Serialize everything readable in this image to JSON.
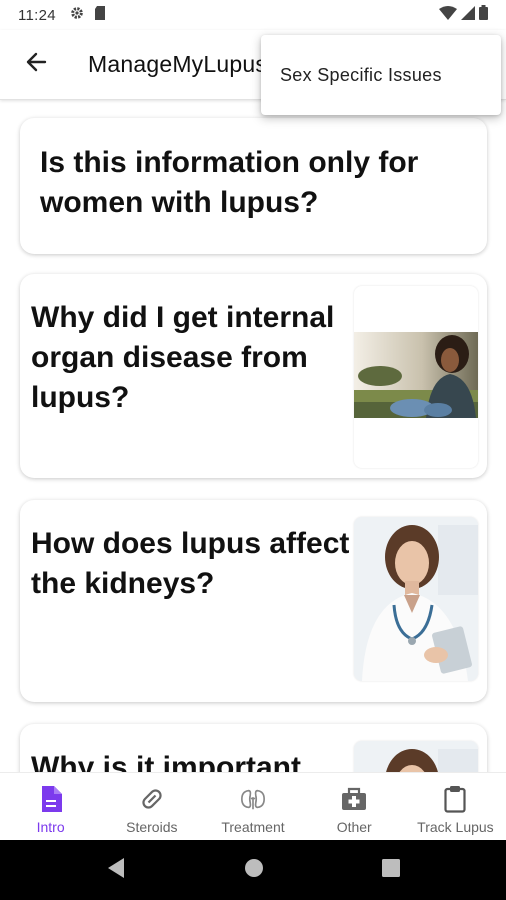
{
  "status_bar": {
    "time": "11:24",
    "left_icons": [
      "gear-icon",
      "sd-card-icon"
    ],
    "right_icons": [
      "wifi-icon",
      "signal-icon",
      "battery-icon"
    ]
  },
  "app_bar": {
    "back_icon": "arrow-back-icon",
    "title": "ManageMyLupus"
  },
  "menu": {
    "items": [
      {
        "label": "Sex Specific Issues"
      }
    ]
  },
  "cards": [
    {
      "title": "Is this information only for women with lupus?",
      "image": null
    },
    {
      "title": "Why did I get internal organ disease from lupus?",
      "image": "woman-sitting-outdoors-photo"
    },
    {
      "title": "How does lupus affect the kidneys?",
      "image": "female-doctor-photo"
    },
    {
      "title": "Why is it important",
      "image": "female-doctor-photo"
    }
  ],
  "bottom_nav": {
    "items": [
      {
        "label": "Intro",
        "icon": "document-icon",
        "active": true
      },
      {
        "label": "Steroids",
        "icon": "pill-icon",
        "active": false
      },
      {
        "label": "Treatment",
        "icon": "kidneys-icon",
        "active": false
      },
      {
        "label": "Other",
        "icon": "medical-kit-icon",
        "active": false
      },
      {
        "label": "Track Lupus",
        "icon": "clipboard-icon",
        "active": false
      }
    ]
  },
  "colors": {
    "accent": "#7c3aed",
    "inactive": "#666666",
    "system_nav": "#000000"
  }
}
